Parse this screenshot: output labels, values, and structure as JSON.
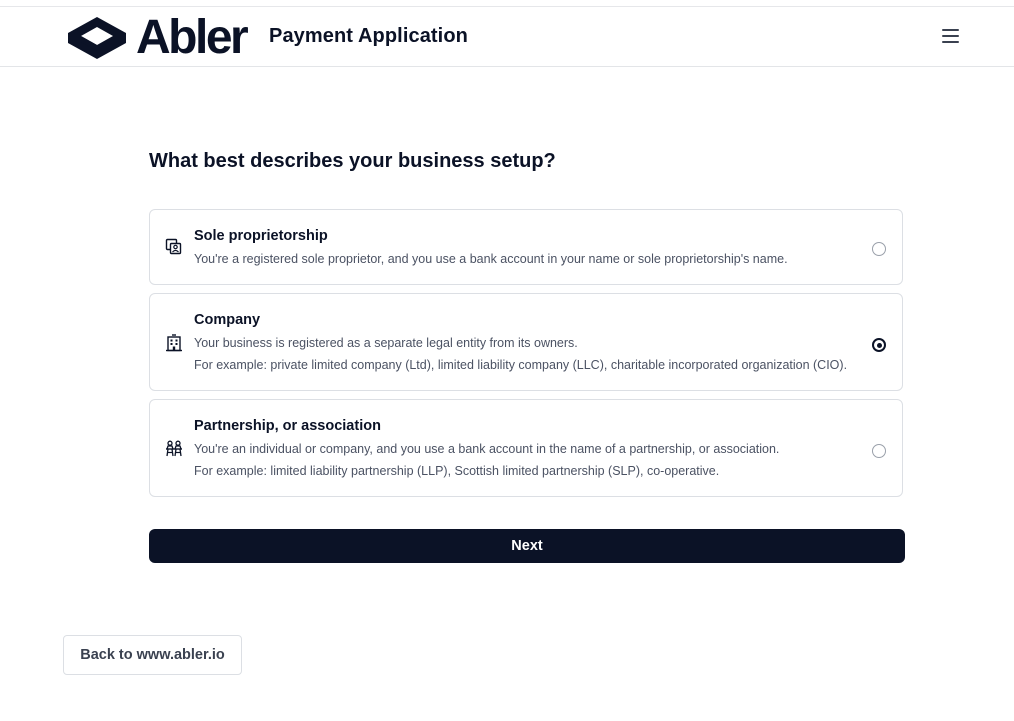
{
  "brand": {
    "logo_text": "Abler",
    "app_title": "Payment Application"
  },
  "header": {
    "menu_icon": "hamburger-menu-icon"
  },
  "form": {
    "question": "What best describes your business setup?",
    "selected_option": "Company",
    "options": [
      {
        "title": "Sole proprietorship",
        "icon": "sole-proprietor-icon",
        "lines": [
          "You're a registered sole proprietor, and you use a bank account in your name or sole proprietorship's name."
        ],
        "selected": false
      },
      {
        "title": "Company",
        "icon": "building-icon",
        "lines": [
          "Your business is registered as a separate legal entity from its owners.",
          "For example: private limited company (Ltd), limited liability company (LLC), charitable incorporated organization (CIO)."
        ],
        "selected": true
      },
      {
        "title": "Partnership, or association",
        "icon": "partnership-icon",
        "lines": [
          "You're an individual or company, and you use a bank account in the name of a partnership, or association.",
          "For example: limited liability partnership (LLP), Scottish limited partnership (SLP), co-operative."
        ],
        "selected": false
      }
    ],
    "next_label": "Next"
  },
  "footer": {
    "back_label": "Back to www.abler.io"
  },
  "colors": {
    "primary": "#0b1226",
    "border": "#dcdfe4",
    "muted_text": "#4b5263"
  }
}
